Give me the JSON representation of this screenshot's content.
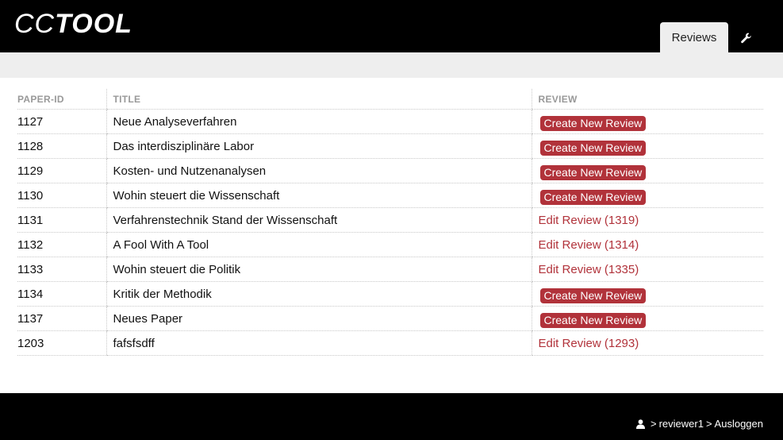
{
  "app": {
    "logo_cc": "CC",
    "logo_tool": "TOOL"
  },
  "nav": {
    "tab_reviews": "Reviews",
    "settings_icon": "wrench-icon"
  },
  "table": {
    "headers": [
      "PAPER-ID",
      "TITLE",
      "REVIEW"
    ],
    "rows": [
      {
        "id": "1127",
        "title": "Neue Analyseverfahren",
        "action": "Create New Review",
        "type": "create"
      },
      {
        "id": "1128",
        "title": "Das interdisziplinäre Labor",
        "action": "Create New Review",
        "type": "create"
      },
      {
        "id": "1129",
        "title": "Kosten- und Nutzenanalysen",
        "action": "Create New Review",
        "type": "create"
      },
      {
        "id": "1130",
        "title": "Wohin steuert die Wissenschaft",
        "action": "Create New Review",
        "type": "create"
      },
      {
        "id": "1131",
        "title": "Verfahrenstechnik Stand der Wissenschaft",
        "action": "Edit Review (1319)",
        "type": "edit"
      },
      {
        "id": "1132",
        "title": "A Fool With A Tool",
        "action": "Edit Review (1314)",
        "type": "edit"
      },
      {
        "id": "1133",
        "title": "Wohin steuert die Politik",
        "action": "Edit Review (1335)",
        "type": "edit"
      },
      {
        "id": "1134",
        "title": "Kritik der Methodik",
        "action": "Create New Review",
        "type": "create"
      },
      {
        "id": "1137",
        "title": "Neues Paper",
        "action": "Create New Review",
        "type": "create"
      },
      {
        "id": "1203",
        "title": "fafsfsdff",
        "action": "Edit Review (1293)",
        "type": "edit"
      }
    ]
  },
  "footer": {
    "user_icon": "user-icon",
    "sep1": ">",
    "username": "reviewer1",
    "sep2": ">",
    "logout": "Ausloggen"
  },
  "colors": {
    "accent": "#b1323a",
    "header_bg": "#000000",
    "subbar_bg": "#eeeeee"
  }
}
